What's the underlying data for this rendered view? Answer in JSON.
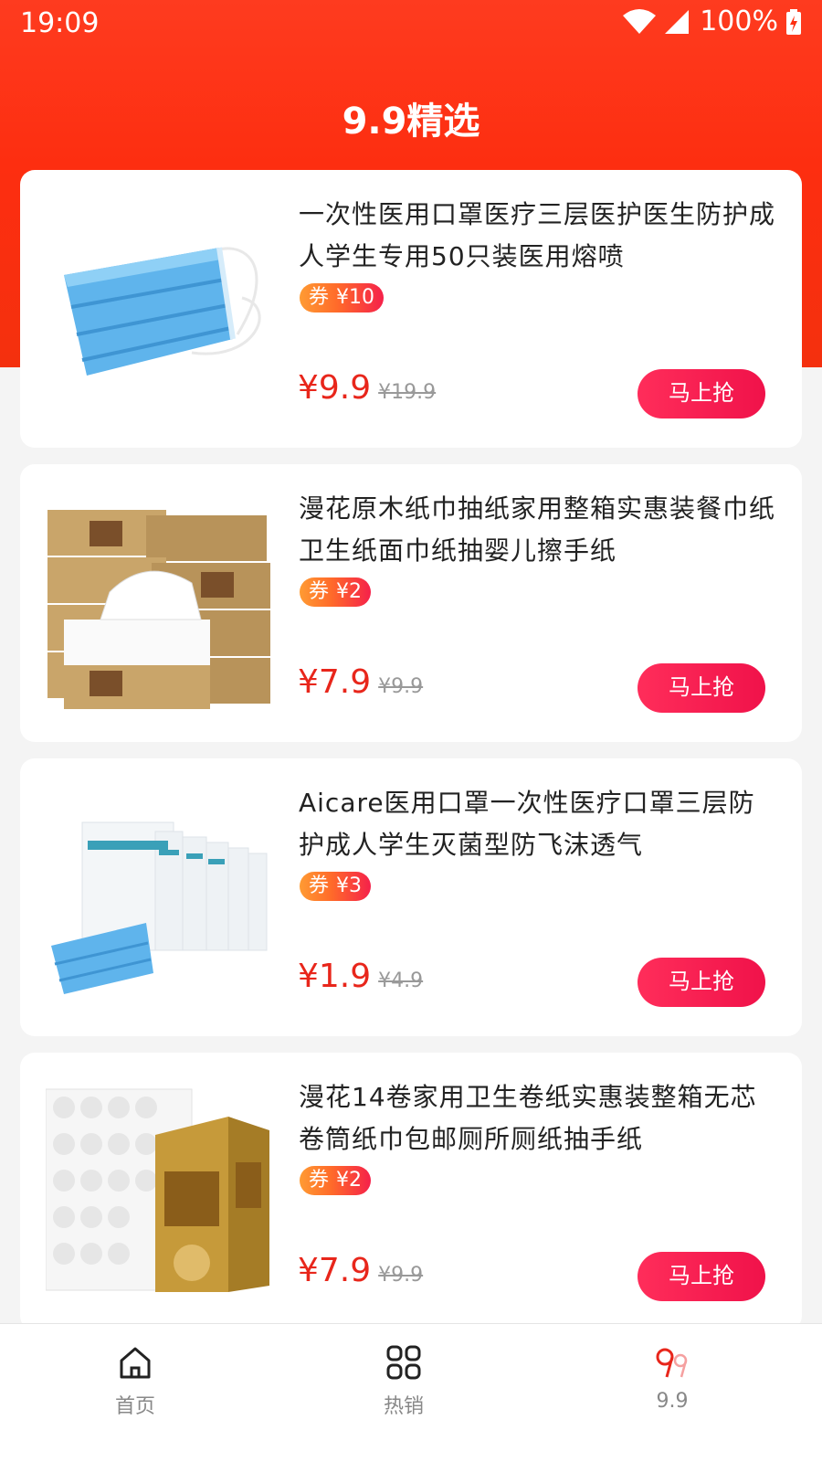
{
  "status_bar": {
    "time": "19:09",
    "battery": "100%"
  },
  "header": {
    "title": "9.9精选"
  },
  "products": [
    {
      "name": "一次性医用口罩医疗三层医护医生防护成人学生专用50只装医用熔喷",
      "coupon_label": "券",
      "coupon_value": "¥10",
      "price": "¥9.9",
      "original_price": "¥19.9",
      "buy_label": "马上抢",
      "image": "mask-image"
    },
    {
      "name": "漫花原木纸巾抽纸家用整箱实惠装餐巾纸卫生纸面巾纸抽婴儿擦手纸",
      "coupon_label": "券",
      "coupon_value": "¥2",
      "price": "¥7.9",
      "original_price": "¥9.9",
      "buy_label": "马上抢",
      "image": "tissue-box-image"
    },
    {
      "name": "Aicare医用口罩一次性医疗口罩三层防护成人学生灭菌型防飞沫透气",
      "coupon_label": "券",
      "coupon_value": "¥3",
      "price": "¥1.9",
      "original_price": "¥4.9",
      "buy_label": "马上抢",
      "image": "mask-pack-image"
    },
    {
      "name": "漫花14卷家用卫生卷纸实惠装整箱无芯卷筒纸巾包邮厕所厕纸抽手纸",
      "coupon_label": "券",
      "coupon_value": "¥2",
      "price": "¥7.9",
      "original_price": "¥9.9",
      "buy_label": "马上抢",
      "image": "toilet-roll-image"
    }
  ],
  "tabbar": {
    "tabs": [
      {
        "label": "首页",
        "icon": "home-icon"
      },
      {
        "label": "热销",
        "icon": "grid-icon"
      },
      {
        "label": "9.9",
        "icon": "nine-nine-icon",
        "active": true
      }
    ]
  },
  "colors": {
    "header": "#fd2e10",
    "price": "#e8261b",
    "buy_button": "#f0124a",
    "active_icon": "#e8261b"
  }
}
